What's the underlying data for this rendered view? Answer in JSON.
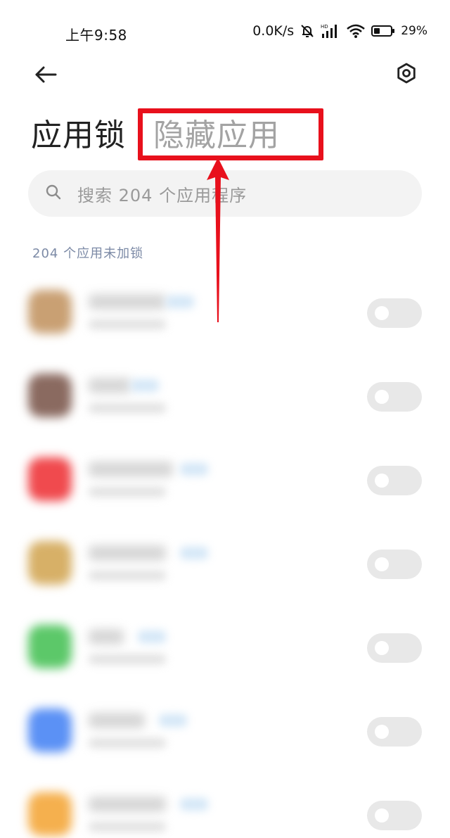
{
  "status_bar": {
    "time": "上午9:58",
    "net_speed": "0.0K/s",
    "battery": "29%",
    "icons": [
      "mute-bell-icon",
      "hd-signal-icon",
      "wifi-icon",
      "battery-icon"
    ]
  },
  "header": {
    "back_icon": "arrow-left-icon",
    "settings_icon": "hexagon-settings-icon",
    "title": "应用锁",
    "alt_title": "隐藏应用"
  },
  "annotation": {
    "highlight_color": "#e8101c",
    "arrow_color": "#e8101c"
  },
  "search": {
    "placeholder": "搜索 204 个应用程序"
  },
  "section": {
    "header": "204 个应用未加锁"
  },
  "apps": [
    {
      "icon_color": "#c9a073",
      "toggle_on": false
    },
    {
      "icon_color": "#8a6a60",
      "toggle_on": false
    },
    {
      "icon_color": "#f04a4e",
      "toggle_on": false
    },
    {
      "icon_color": "#d7b067",
      "toggle_on": false
    },
    {
      "icon_color": "#5cc869",
      "toggle_on": false
    },
    {
      "icon_color": "#5b91f5",
      "toggle_on": false
    },
    {
      "icon_color": "#f5b04e",
      "toggle_on": false
    }
  ],
  "colors": {
    "section_header": "#7c8aa6",
    "toggle_off": "#e8e8e8",
    "search_bg": "#f3f3f3"
  }
}
